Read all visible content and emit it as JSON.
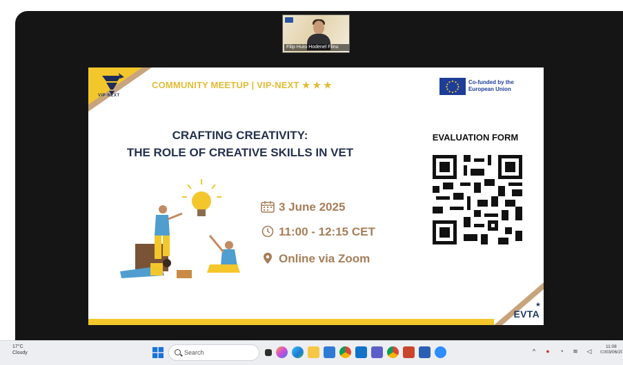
{
  "participant": {
    "name_label": "Filip Huisi Hodenel Flinu"
  },
  "slide": {
    "meetup_label": "COMMUNITY MEETUP | VIP-NEXT",
    "stars": "★ ★ ★",
    "vip_logo_text": "VIP·NEXT",
    "eu_label": "Co-funded by the European Union",
    "title_line1": "CRAFTING CREATIVITY:",
    "title_line2": "THE ROLE OF CREATIVE SKILLS IN VET",
    "date": "3 June 2025",
    "time": "11:00 - 12:15 CET",
    "location": "Online via Zoom",
    "evaluation_label": "EVALUATION FORM",
    "evta_logo": "EVTA",
    "colors": {
      "yellow": "#f3c62c",
      "tan": "#c7a47c",
      "navy": "#24314f",
      "info_brown": "#a67d57",
      "eu_blue": "#1d3d97"
    }
  },
  "taskbar": {
    "weather": "17°C\nCloudy",
    "search_placeholder": "Search",
    "clock": "11:08\n03/06/2025",
    "icons": [
      "windows-start-icon",
      "search-icon",
      "file-explorer-icon",
      "copilot-icon",
      "edge-icon",
      "folder-icon",
      "store-icon",
      "chrome-icon",
      "outlook-icon",
      "teams-icon",
      "chrome-alt-icon",
      "powerpoint-icon",
      "word-icon",
      "zoom-icon"
    ]
  }
}
